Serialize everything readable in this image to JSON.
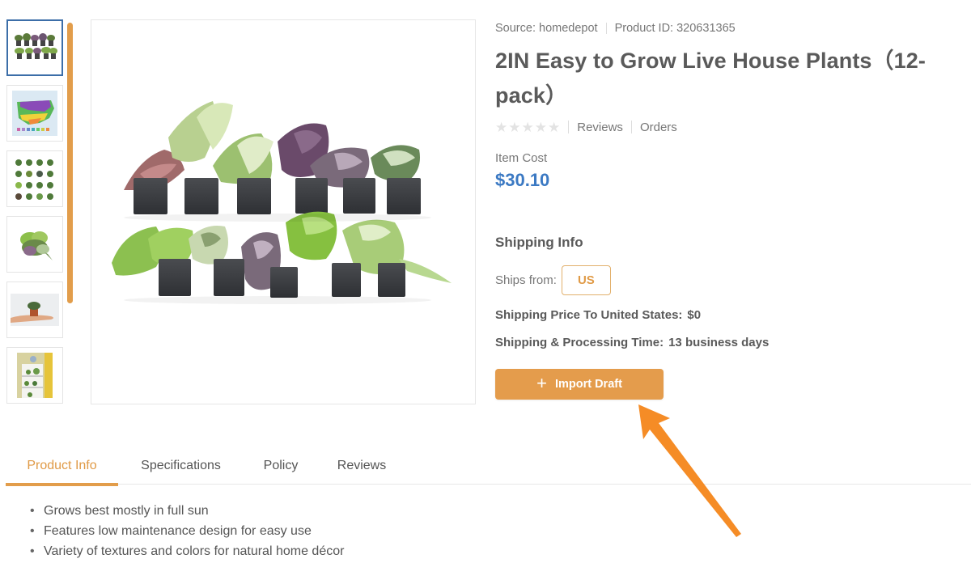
{
  "gallery": {
    "thumbnails": [
      {
        "name": "plants-group",
        "active": true
      },
      {
        "name": "hardiness-zone-map",
        "active": false
      },
      {
        "name": "plant-variety-grid",
        "active": false
      },
      {
        "name": "plant-bunch",
        "active": false
      },
      {
        "name": "plant-in-hand",
        "active": false
      },
      {
        "name": "plants-on-shelf",
        "active": false
      }
    ],
    "main_image_alt": "12 potted house plants in two rows"
  },
  "product": {
    "source_label": "Source: homedepot",
    "product_id_label": "Product ID: 320631365",
    "title": "2IN Easy to Grow Live House Plants（12-pack）",
    "rating": {
      "stars": 0,
      "max": 5,
      "reviews_label": "Reviews",
      "orders_label": "Orders"
    },
    "cost_label": "Item Cost",
    "cost": "$30.10"
  },
  "shipping": {
    "title": "Shipping Info",
    "ships_from_label": "Ships from:",
    "ships_from_value": "US",
    "price_label": "Shipping Price To United States:",
    "price_value": "$0",
    "time_label": "Shipping & Processing Time:",
    "time_value": "13 business days"
  },
  "actions": {
    "import_label": "Import Draft",
    "import_icon": "plus-icon"
  },
  "tabs": [
    {
      "label": "Product Info",
      "active": true
    },
    {
      "label": "Specifications",
      "active": false
    },
    {
      "label": "Policy",
      "active": false
    },
    {
      "label": "Reviews",
      "active": false
    }
  ],
  "description": [
    "Grows best mostly in full sun",
    "Features low maintenance design for easy use",
    "Variety of textures and colors for natural home décor"
  ],
  "colors": {
    "accent": "#e49c4c",
    "price": "#3b79c3",
    "active_thumb_border": "#3c6ea8",
    "annotation_arrow": "#f5881f"
  }
}
